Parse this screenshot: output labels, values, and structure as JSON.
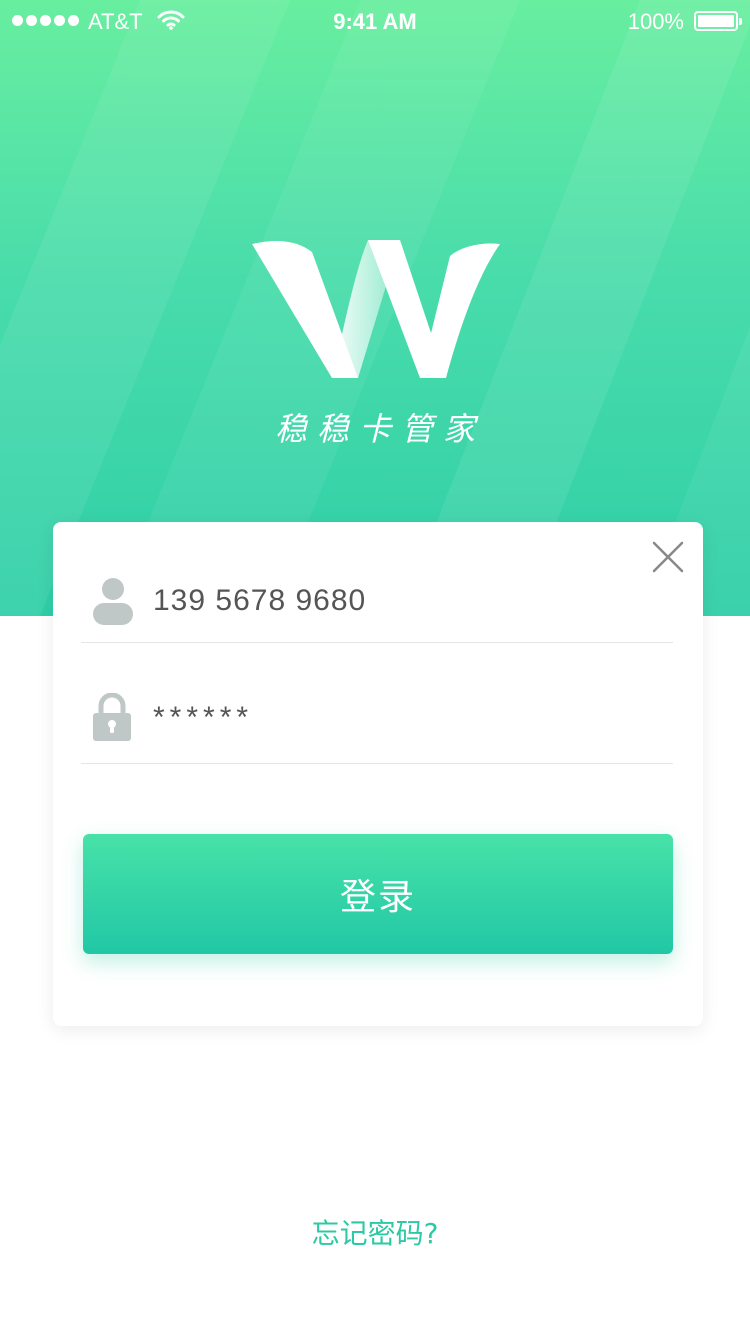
{
  "status_bar": {
    "carrier": "AT&T",
    "time": "9:41 AM",
    "battery": "100%",
    "signal_icon": "signal-dots-icon",
    "wifi_icon": "wifi-icon",
    "battery_icon": "battery-icon"
  },
  "brand": {
    "logo_icon": "w-logo-icon",
    "name": "稳稳卡管家"
  },
  "login_form": {
    "close_icon": "close-icon",
    "username": {
      "icon": "user-icon",
      "value": "139 5678 9680"
    },
    "password": {
      "icon": "lock-icon",
      "value": "******"
    },
    "submit_label": "登录"
  },
  "forgot_password": "忘记密码?",
  "colors": {
    "accent": "#2CC9A4",
    "gradient_top": "#68EE9F",
    "gradient_bottom": "#21C7A6",
    "icon_gray": "#BFC7C7"
  }
}
